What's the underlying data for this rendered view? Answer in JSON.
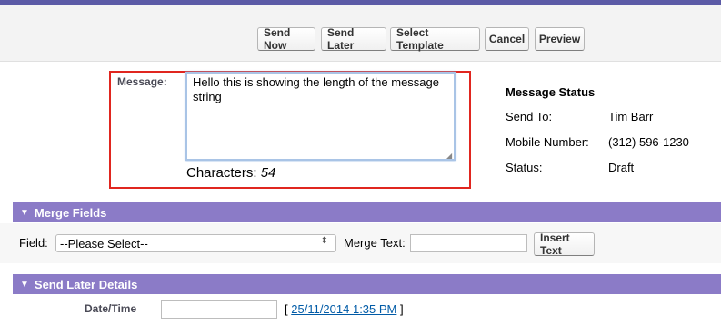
{
  "toolbar": {
    "send_now": "Send Now",
    "send_later": "Send Later",
    "select_template": "Select Template",
    "cancel": "Cancel",
    "preview": "Preview"
  },
  "message": {
    "label": "Message:",
    "text": "Hello this is showing the length of the message string",
    "characters_label": "Characters:",
    "characters_count": "54"
  },
  "message_status": {
    "title": "Message Status",
    "send_to_label": "Send To:",
    "send_to_value": "Tim Barr",
    "mobile_label": "Mobile Number:",
    "mobile_value": "(312) 596-1230",
    "status_label": "Status:",
    "status_value": "Draft"
  },
  "merge_fields": {
    "header": "Merge Fields",
    "field_label": "Field:",
    "field_selected": "--Please Select--",
    "merge_text_label": "Merge Text:",
    "merge_text_value": "",
    "insert_button": "Insert Text"
  },
  "send_later_details": {
    "header": "Send Later Details",
    "datetime_label": "Date/Time",
    "datetime_value": "",
    "bracket_open": "[",
    "default_datetime": "25/11/2014 1:35 PM",
    "bracket_close": "]"
  },
  "colors": {
    "top_bar": "#5b5aa6",
    "section_header": "#8b7bc7",
    "highlight_border": "#e0261f",
    "link": "#015ba7"
  }
}
